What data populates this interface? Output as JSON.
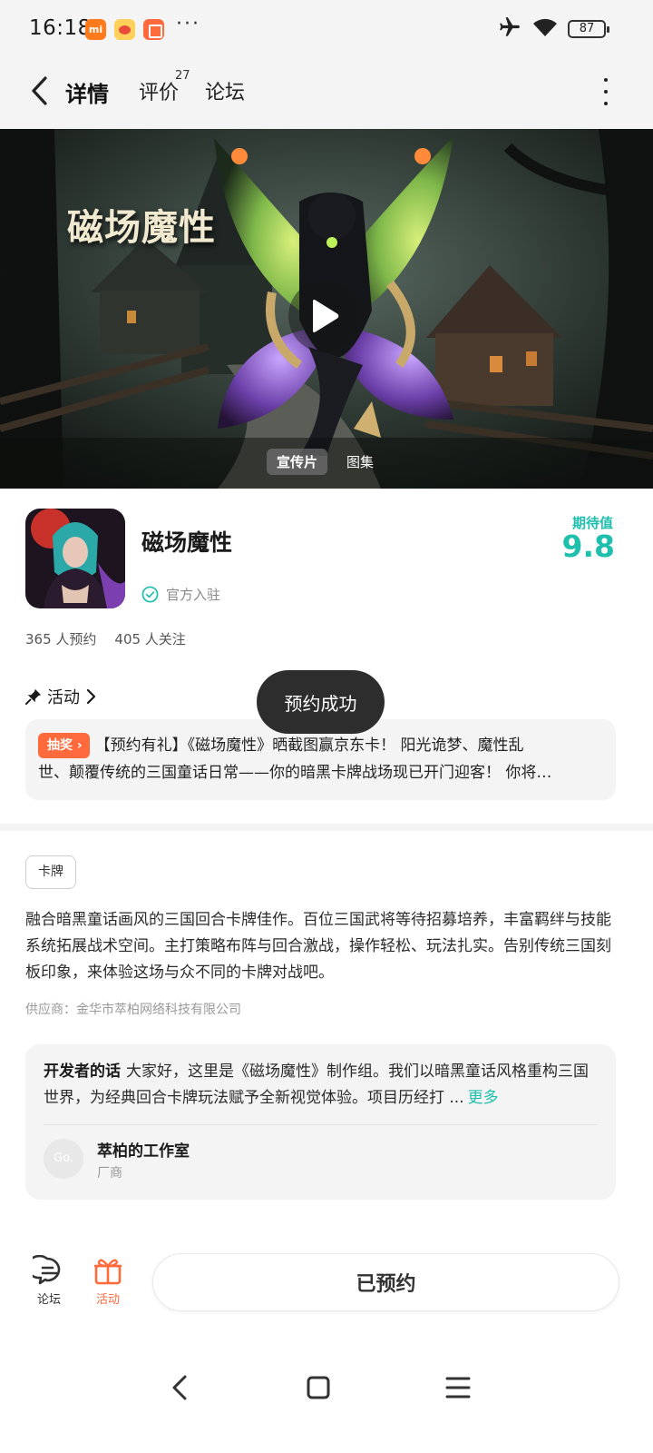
{
  "status_bar": {
    "time": "16:18",
    "mi_badge": "mi",
    "more": "···",
    "battery": "87"
  },
  "header": {
    "tabs": [
      {
        "label": "详情",
        "active": true
      },
      {
        "label": "评价",
        "count": "27"
      },
      {
        "label": "论坛"
      }
    ],
    "accent_color": "#2ccfc0"
  },
  "hero": {
    "title": "磁场魔性",
    "media_tabs": [
      "宣传片",
      "图集"
    ]
  },
  "game": {
    "name": "磁场魔性",
    "official_label": "官方入驻",
    "expect_label": "期待值",
    "expect_score": "9.8",
    "reservations": "365 人预约",
    "followers": "405 人关注"
  },
  "activity": {
    "label": "活动",
    "lottery_tag": "抽奖",
    "promo_line1": "【预约有礼】《磁场魔性》晒截图赢京东卡！ 阳光诡梦、魔性乱",
    "promo_line2": "世、颠覆传统的三国童话日常——你的暗黑卡牌战场现已开门迎客！   你将…"
  },
  "toast": "预约成功",
  "details": {
    "genre_tag": "卡牌",
    "description": "融合暗黑童话画风的三国回合卡牌佳作。百位三国武将等待招募培养，丰富羁绊与技能系统拓展战术空间。主打策略布阵与回合激战，操作轻松、玩法扎实。告别传统三国刻板印象，来体验这场与众不同的卡牌对战吧。",
    "supplier": "供应商：金华市萃柏网络科技有限公司"
  },
  "developer": {
    "heading": "开发者的话",
    "text": "大家好，这里是《磁场魔性》制作组。我们以暗黑童话风格重构三国世界，为经典回合卡牌玩法赋予全新视觉体验。项目历经打 ...",
    "more_label": "更多",
    "avatar_text": "Go.",
    "studio_name": "萃柏的工作室",
    "studio_role": "厂商"
  },
  "bottom_bar": {
    "forum_label": "论坛",
    "activity_label": "活动",
    "reserve_button": "已预约",
    "activity_color": "#ff6a3d"
  }
}
